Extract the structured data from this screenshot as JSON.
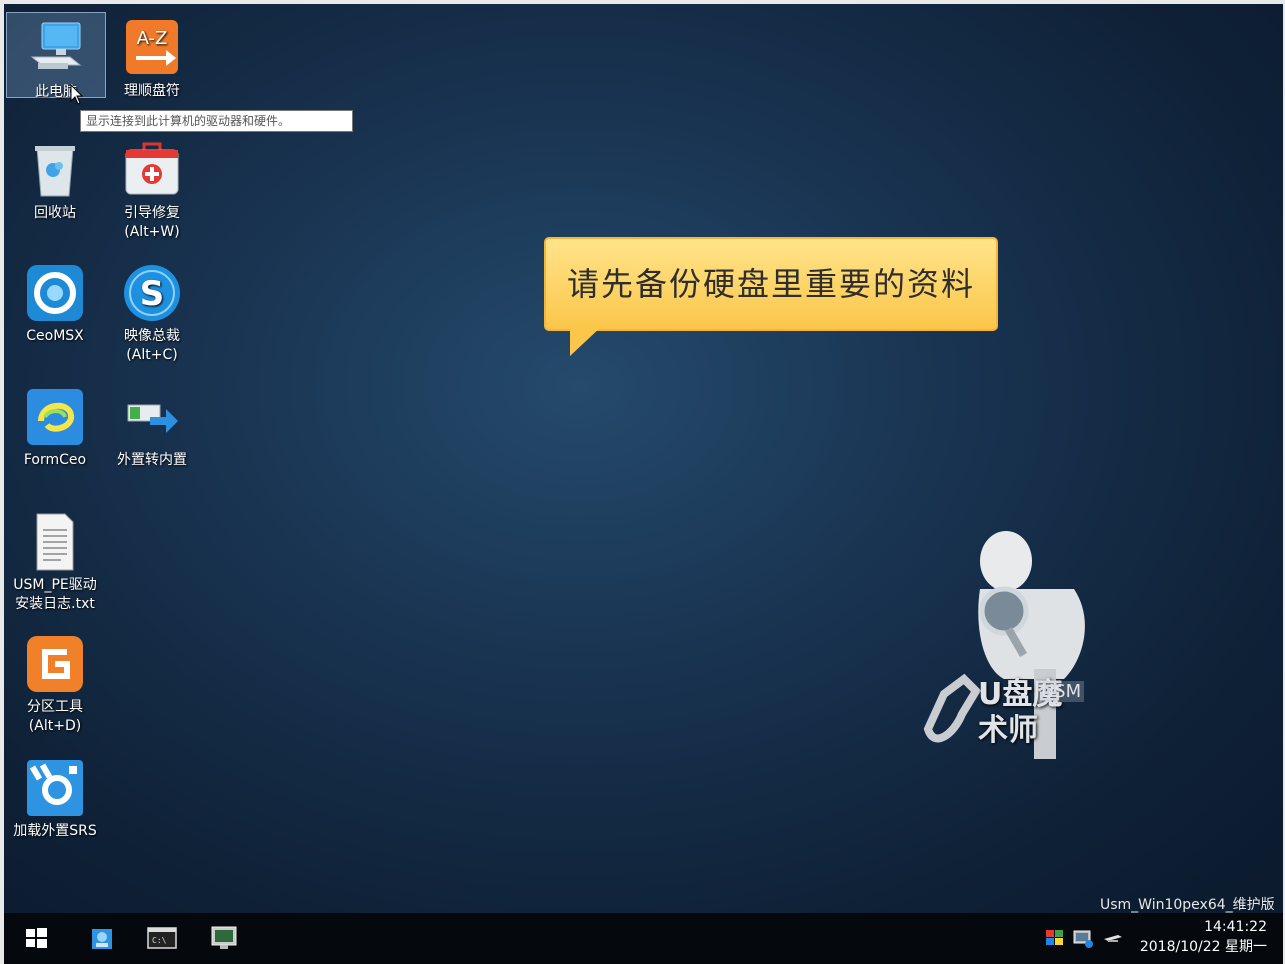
{
  "desktop": {
    "icons_col1": [
      {
        "label": "此电脑",
        "icon": "computer-icon"
      },
      {
        "label": "回收站",
        "icon": "recycle-bin-icon"
      },
      {
        "label": "CeoMSX",
        "icon": "ceomsx-icon"
      },
      {
        "label": "FormCeo",
        "icon": "formceo-icon"
      },
      {
        "label": "USM_PE驱动",
        "label2": "安装日志.txt",
        "icon": "text-file-icon"
      },
      {
        "label": "分区工具",
        "label2": "(Alt+D)",
        "icon": "partition-tool-icon"
      },
      {
        "label": "加载外置SRS",
        "icon": "load-srs-icon"
      }
    ],
    "icons_col2": [
      {
        "label": "理顺盘符",
        "icon": "drive-letter-icon"
      },
      {
        "label": "引导修复",
        "label2": "(Alt+W)",
        "icon": "boot-repair-icon"
      },
      {
        "label": "映像总裁",
        "label2": "(Alt+C)",
        "icon": "image-tool-icon"
      },
      {
        "label": "外置转内置",
        "icon": "convert-icon"
      }
    ],
    "tooltip": "显示连接到此计算机的驱动器和硬件。",
    "callout": "请先备份硬盘里重要的资料",
    "logo_text": "U盘魔术师",
    "logo_badge": "USM",
    "version_text": "Usm_Win10pex64_维护版"
  },
  "taskbar": {
    "time": "14:41:22",
    "date": "2018/10/22 星期一",
    "items": [
      "start-icon",
      "setup-icon",
      "terminal-icon",
      "monitor-icon"
    ],
    "tray": [
      "flag-icon",
      "network-icon",
      "usb-icon"
    ]
  },
  "colors": {
    "callout_bg": "#fbc64a",
    "taskbar": "#05080c",
    "desktop": "#18324f"
  }
}
